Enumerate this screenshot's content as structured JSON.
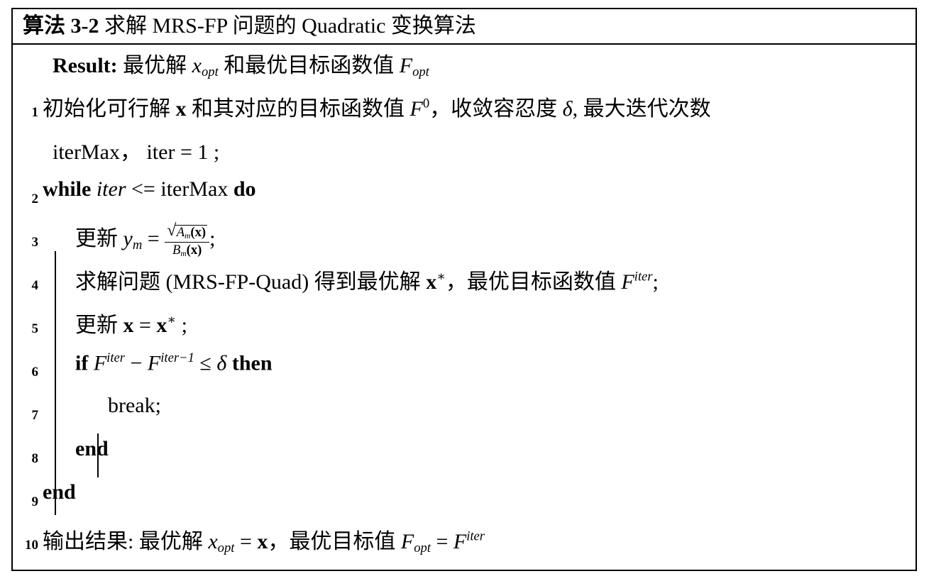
{
  "algorithm": {
    "title": {
      "label": "算法",
      "number": "3-2",
      "description": "求解 MRS-FP 问题的 Quadratic 变换算法"
    },
    "result": {
      "keyword": "Result:",
      "text_1": "最优解",
      "var_x": "x",
      "var_x_sub": "opt",
      "text_2": "和最优目标函数值",
      "var_f": "F",
      "var_f_sub": "opt"
    },
    "lines": [
      {
        "number": "1",
        "text": "初始化可行解 x 和其对应的目标函数值 F0，收敛容忍度 δ, 最大迭代次数",
        "parts": {
          "p1": "初始化可行解",
          "bold_x": "x",
          "p2": "和其对应的目标函数值",
          "var_f": "F",
          "sup_f": "0",
          "p3": "，收敛容忍度",
          "delta": "δ",
          "p4": ", 最大迭代次数"
        }
      },
      {
        "number": "",
        "text": "iterMax， iter = 1 ;",
        "parts": {
          "p1": "iterMax，",
          "p2": "iter = 1 ;"
        }
      },
      {
        "number": "2",
        "text": "while iter <= iterMax do",
        "parts": {
          "kw_while": "while",
          "var_iter": "iter",
          "op": "<=",
          "var_itermax": "iterMax",
          "kw_do": "do"
        }
      },
      {
        "number": "3",
        "text": "更新 ym = sqrt(Am(x)) / Bm(x);",
        "parts": {
          "p1": "更新",
          "var_y": "y",
          "sub_y": "m",
          "eq": "=",
          "num_a": "A",
          "num_a_sub": "m",
          "num_a_arg": "(x)",
          "den_b": "B",
          "den_b_sub": "m",
          "den_b_arg": "(x)",
          "semi": ";"
        }
      },
      {
        "number": "4",
        "text": "求解问题 (MRS-FP-Quad) 得到最优解 x*，最优目标函数值 Fiter;",
        "parts": {
          "p1": "求解问题",
          "problem": "(MRS-FP-Quad)",
          "p2": "得到最优解",
          "bold_x": "x",
          "star": "∗",
          "p3": "，最优目标函数值",
          "var_f": "F",
          "sup_f": "iter",
          "semi": ";"
        }
      },
      {
        "number": "5",
        "text": "更新 x = x* ;",
        "parts": {
          "p1": "更新",
          "bold_x1": "x",
          "eq": "=",
          "bold_x2": "x",
          "star": "∗",
          "semi": ";"
        }
      },
      {
        "number": "6",
        "text": "if Fiter − Fiter−1 ≤ δ then",
        "parts": {
          "kw_if": "if",
          "var_f1": "F",
          "sup_f1": "iter",
          "minus": "−",
          "var_f2": "F",
          "sup_f2": "iter−1",
          "leq": "≤",
          "delta": "δ",
          "kw_then": "then"
        }
      },
      {
        "number": "7",
        "text": "break;",
        "parts": {
          "p1": "break;"
        }
      },
      {
        "number": "8",
        "text": "end",
        "parts": {
          "kw_end": "end"
        }
      },
      {
        "number": "9",
        "text": "end",
        "parts": {
          "kw_end": "end"
        }
      },
      {
        "number": "10",
        "text": "输出结果: 最优解 xopt = x，最优目标值 Fopt = Fiter",
        "parts": {
          "p1": "输出结果:",
          "p2": "最优解",
          "var_x": "x",
          "sub_x": "opt",
          "eq1": "=",
          "bold_x": "x",
          "p3": "，最优目标值",
          "var_f1": "F",
          "sub_f1": "opt",
          "eq2": "=",
          "var_f2": "F",
          "sup_f2": "iter"
        }
      }
    ]
  }
}
